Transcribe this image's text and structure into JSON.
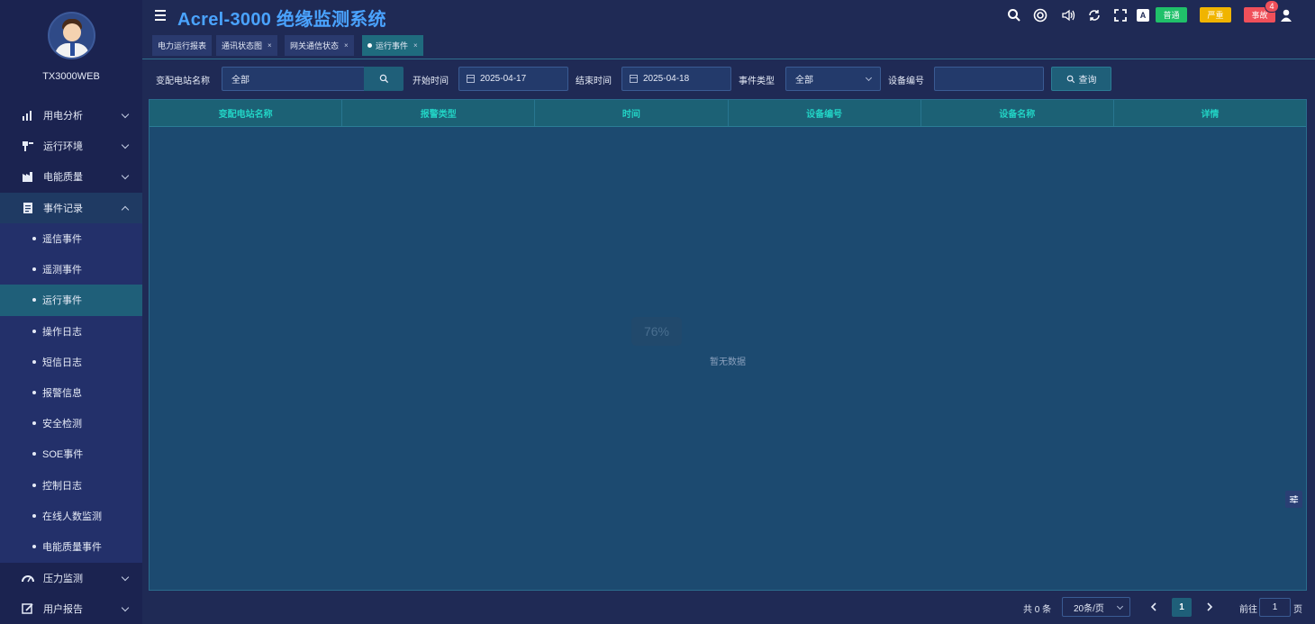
{
  "app": {
    "title": "Acrel-3000 绝缘监测系统"
  },
  "user": {
    "name": "TX3000WEB"
  },
  "sidebar": {
    "groups": [
      {
        "label": "用电分析",
        "icon": "bar-chart-icon"
      },
      {
        "label": "运行环境",
        "icon": "environment-icon"
      },
      {
        "label": "电能质量",
        "icon": "factory-icon"
      },
      {
        "label": "事件记录",
        "icon": "document-icon",
        "open": true
      },
      {
        "label": "压力监测",
        "icon": "gauge-icon"
      },
      {
        "label": "用户报告",
        "icon": "edit-icon"
      }
    ],
    "event_items": [
      "遥信事件",
      "遥测事件",
      "运行事件",
      "操作日志",
      "短信日志",
      "报警信息",
      "安全检测",
      "SOE事件",
      "控制日志",
      "在线人数监测",
      "电能质量事件"
    ],
    "active_item": "运行事件"
  },
  "header": {
    "badges": {
      "normal": "普通",
      "serious": "严重",
      "accident": "事故"
    },
    "notification_count": "4",
    "badge_colors": {
      "normal": "#20c06a",
      "serious": "#f0b400",
      "accident": "#f0505a"
    },
    "icons": [
      "search-icon",
      "help-icon",
      "volume-icon",
      "refresh-icon",
      "fullscreen-icon",
      "translate-icon",
      "user-icon"
    ]
  },
  "tabs": [
    {
      "label": "电力运行报表",
      "closable": false
    },
    {
      "label": "通讯状态图",
      "closable": true
    },
    {
      "label": "网关通信状态",
      "closable": true
    },
    {
      "label": "运行事件",
      "closable": true,
      "active": true
    }
  ],
  "filters": {
    "station_label": "变配电站名称",
    "station_value": "全部",
    "start_label": "开始时间",
    "start_value": "2025-04-17",
    "end_label": "结束时间",
    "end_value": "2025-04-18",
    "event_type_label": "事件类型",
    "event_type_value": "全部",
    "device_no_label": "设备编号",
    "device_no_value": "",
    "query_label": "查询"
  },
  "table": {
    "columns": [
      "变配电站名称",
      "报警类型",
      "时间",
      "设备编号",
      "设备名称",
      "详情"
    ],
    "rows": [],
    "loading_text": "76%",
    "empty_text": "暂无数据"
  },
  "pagination": {
    "total_text": "共 0 条",
    "page_size": "20条/页",
    "current_page": "1",
    "goto_label": "前往",
    "goto_value": "1",
    "page_unit": "页"
  },
  "colors": {
    "accent": "#4aa3ff",
    "teal": "#22d3c5",
    "active": "#1f5f79"
  }
}
